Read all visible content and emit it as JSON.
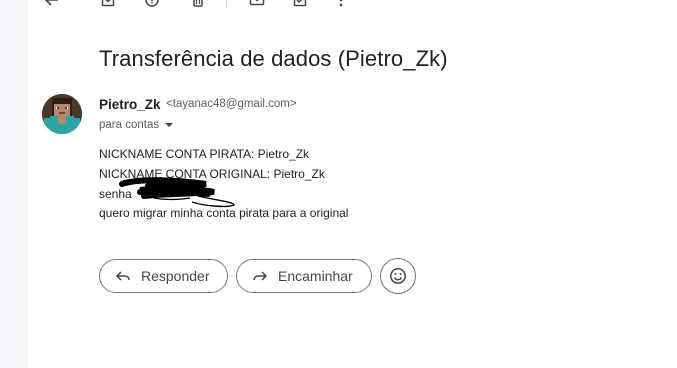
{
  "toolbar": {
    "icons": [
      "back-arrow-icon",
      "move-to-inbox-icon",
      "report-spam-icon",
      "delete-icon",
      "mark-unread-icon",
      "add-to-tasks-icon",
      "more-vert-icon"
    ]
  },
  "email": {
    "subject": "Transferência de dados (Pietro_Zk)",
    "sender_name": "Pietro_Zk",
    "sender_email": "<tayanac48@gmail.com>",
    "recipient_label": "para contas",
    "body_lines": [
      "NICKNAME CONTA PIRATA: Pietro_Zk",
      "NICKNAME CONTA ORIGINAL: Pietro_Zk",
      "senha",
      "quero migrar minha conta pirata para a original"
    ]
  },
  "actions": {
    "reply_label": "Responder",
    "forward_label": "Encaminhar",
    "emoji_icon": "emoji-reaction-icon"
  },
  "colors": {
    "text_primary": "#1f1f1f",
    "text_secondary": "#5e5e5e",
    "icon": "#444746",
    "chip_border": "#747775",
    "sidebar_bg": "#f6f8fc"
  }
}
